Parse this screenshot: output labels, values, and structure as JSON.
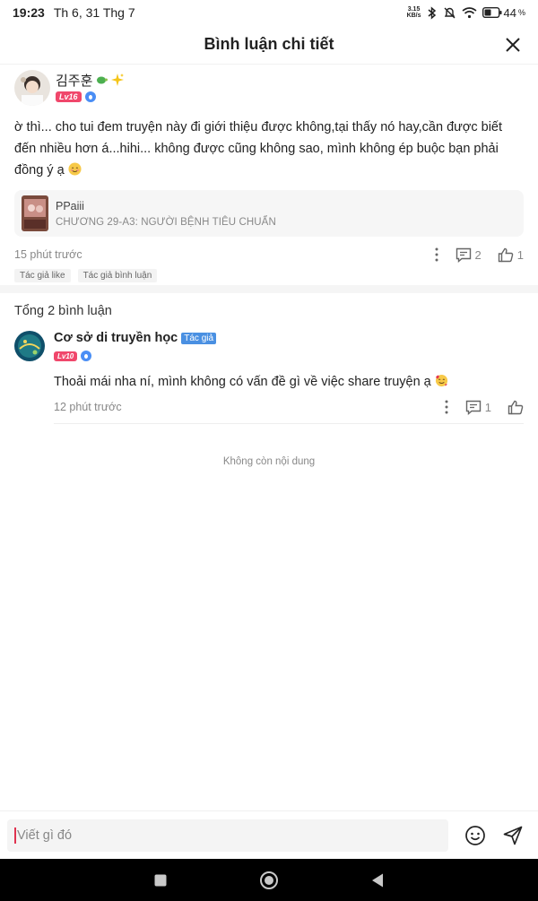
{
  "status_bar": {
    "time": "19:23",
    "date": "Th 6, 31 Thg 7",
    "net_speed_value": "3.15",
    "net_speed_unit": "KB/s",
    "battery": "44"
  },
  "header": {
    "title": "Bình luận chi tiết"
  },
  "comment": {
    "author": "김주훈",
    "level": "Lv16",
    "text": "ờ thì... cho tui đem truyện này đi giới thiệu được không,tại thấy nó hay,cần được biết đến nhiều hơn á...hihi... không được cũng không sao, mình không ép buộc bạn phải đồng ý ạ",
    "chapter": {
      "title": "PPaiii",
      "subtitle": "CHƯƠNG 29-A3: NGƯỜI BỆNH TIÊU CHUẨN"
    },
    "time_ago": "15 phút trước",
    "reply_count": "2",
    "like_count": "1",
    "tags": [
      "Tác giả like",
      "Tác giả bình luận"
    ]
  },
  "replies_section": {
    "total_label": "Tổng 2 bình luận",
    "replies": [
      {
        "author": "Cơ sở di truyền học",
        "author_badge": "Tác giả",
        "level": "Lv10",
        "text": "Thoải mái nha ní, mình không có vấn đề gì về việc share truyện ạ",
        "time_ago": "12 phút trước",
        "reply_count": "1"
      }
    ],
    "end_text": "Không còn nội dung"
  },
  "input": {
    "placeholder": "Viết gì đó"
  },
  "colors": {
    "level_badge": "#f0476b",
    "author_badge": "#4a90e2",
    "caret": "#e0334f"
  }
}
